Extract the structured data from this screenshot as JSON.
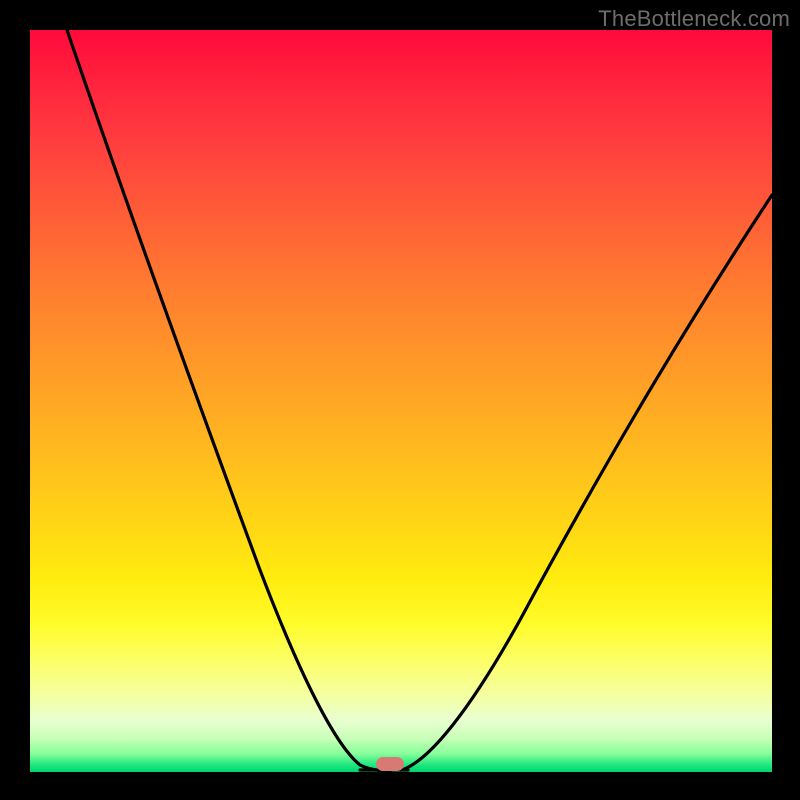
{
  "watermark": "TheBottleneck.com",
  "chart_data": {
    "type": "line",
    "title": "",
    "xlabel": "",
    "ylabel": "",
    "xlim": [
      0,
      100
    ],
    "ylim": [
      0,
      100
    ],
    "grid": false,
    "legend": false,
    "x": [
      5,
      10,
      15,
      20,
      25,
      30,
      35,
      40,
      43,
      46,
      47,
      48,
      50,
      55,
      60,
      65,
      70,
      75,
      80,
      85,
      90,
      95,
      100
    ],
    "values": [
      100,
      86,
      72,
      59,
      47,
      36,
      26,
      15,
      7,
      2,
      0.5,
      0,
      0,
      2,
      8,
      16,
      25,
      35,
      45,
      55,
      64,
      72,
      78
    ],
    "series_note": "V-shaped bottleneck curve; minimum near x≈48 at y≈0",
    "marker": {
      "x": 48,
      "y": 0
    },
    "background_gradient": {
      "top": "#ff0a3a",
      "mid": "#ffd000",
      "bottom": "#00d46e"
    }
  }
}
